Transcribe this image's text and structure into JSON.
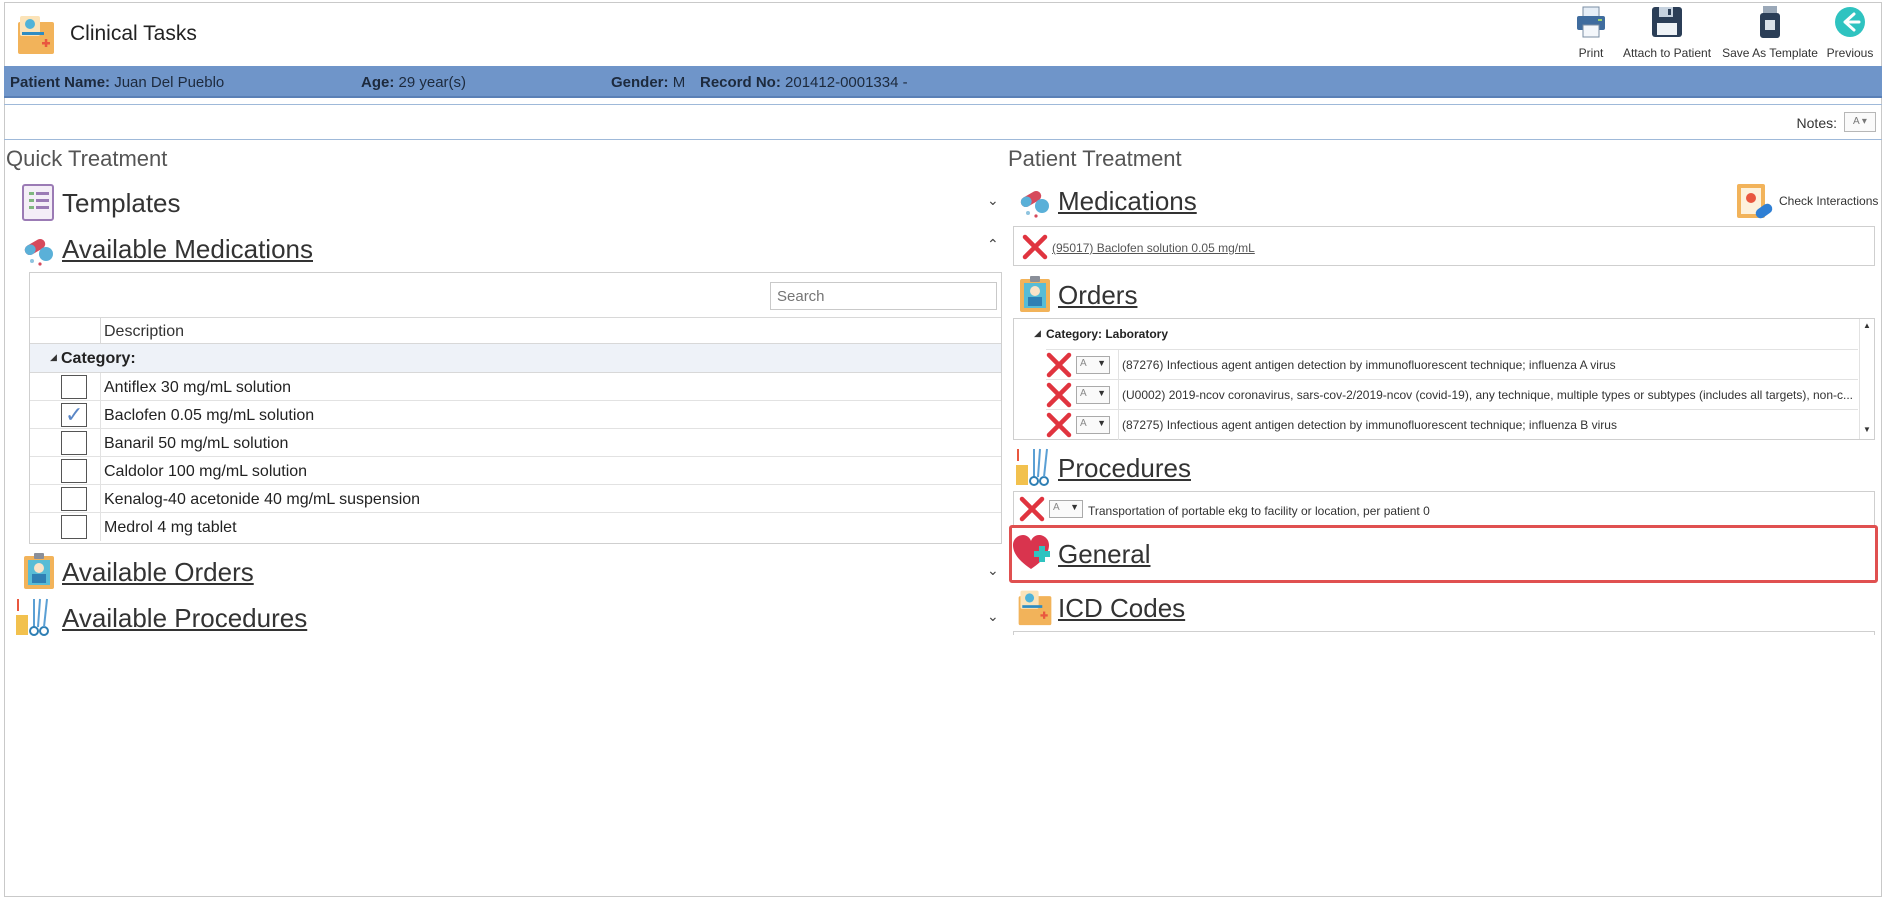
{
  "app": {
    "title": "Clinical Tasks"
  },
  "toolbar": {
    "print_label": "Print",
    "attach_label": "Attach to Patient",
    "save_template_label": "Save As Template",
    "previous_label": "Previous"
  },
  "patient": {
    "name_label": "Patient Name:",
    "name_value": "Juan Del Pueblo",
    "age_label": "Age:",
    "age_value": "29 year(s)",
    "gender_label": "Gender:",
    "gender_value": "M",
    "record_label": "Record No:",
    "record_value": "201412-0001334 -"
  },
  "notes": {
    "label": "Notes:",
    "dropdown_glyph": "A"
  },
  "quick_treatment": {
    "title": "Quick Treatment",
    "templates_label": "Templates",
    "available_medications_label": "Available Medications",
    "search_placeholder": "Search",
    "column_description": "Description",
    "category_label": "Category:",
    "medications": [
      {
        "label": "Antiflex 30 mg/mL solution",
        "checked": false
      },
      {
        "label": "Baclofen 0.05 mg/mL solution",
        "checked": true
      },
      {
        "label": "Banaril 50 mg/mL solution",
        "checked": false
      },
      {
        "label": "Caldolor 100 mg/mL solution",
        "checked": false
      },
      {
        "label": "Kenalog-40 acetonide 40 mg/mL suspension",
        "checked": false
      },
      {
        "label": "Medrol 4 mg tablet",
        "checked": false
      }
    ],
    "available_orders_label": "Available Orders",
    "available_procedures_label": "Available Procedures"
  },
  "patient_treatment": {
    "title": "Patient Treatment",
    "medications_label": "Medications",
    "check_interactions_label": "Check Interactions",
    "medication_items": [
      "(95017) Baclofen solution 0.05 mg/mL"
    ],
    "orders_label": "Orders",
    "orders_category": "Category: Laboratory",
    "order_items": [
      "(87276) Infectious agent antigen detection by immunofluorescent technique; influenza A virus",
      "(U0002) 2019-ncov coronavirus, sars-cov-2/2019-ncov (covid-19), any technique, multiple types or subtypes (includes all targets), non-c...",
      "(87275) Infectious agent antigen detection by immunofluorescent technique; influenza B virus"
    ],
    "procedures_label": "Procedures",
    "procedure_items": [
      "Transportation of portable ekg to facility or location, per patient 0"
    ],
    "general_label": "General",
    "icd_label": "ICD Codes"
  },
  "colors": {
    "patient_bar": "#6f95c9",
    "highlight": "#e05050",
    "delete_x": "#e0343f",
    "checkmark": "#5a86c6"
  }
}
